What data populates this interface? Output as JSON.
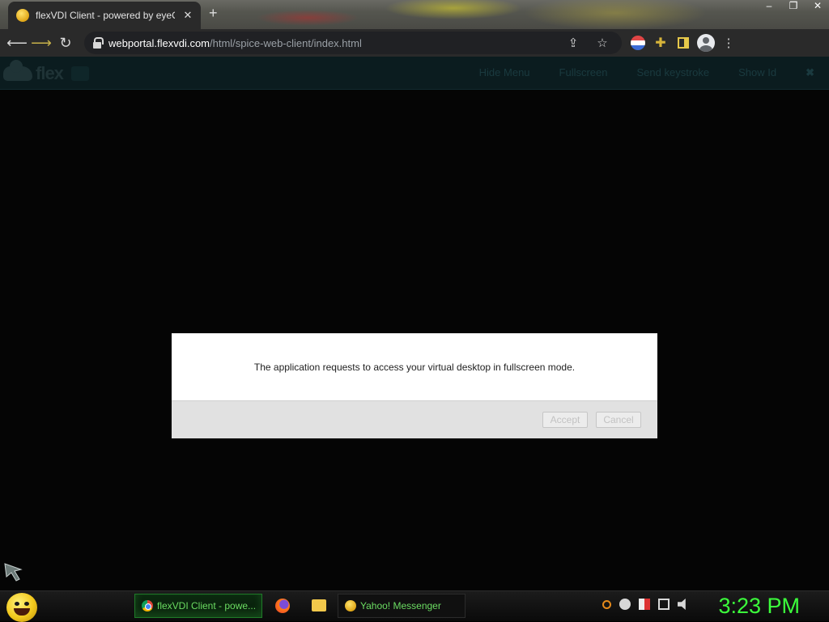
{
  "browser": {
    "tab": {
      "title": "flexVDI Client - powered by eyeO"
    },
    "new_tab_symbol": "+",
    "window_controls": [
      "–",
      "❐",
      "✕"
    ],
    "url": {
      "host": "webportal.flexvdi.com",
      "path": "/html/spice-web-client/index.html"
    },
    "icons": [
      "back-icon",
      "forward-icon",
      "reload-icon",
      "share-icon",
      "star-icon",
      "extension-icon",
      "side-panel-icon",
      "profile-icon",
      "menu-icon"
    ]
  },
  "app": {
    "logo_text": "flex",
    "menu": {
      "hide_menu": "Hide Menu",
      "fullscreen": "Fullscreen",
      "send_keystroke": "Send keystroke",
      "show_id": "Show Id",
      "close": "✖"
    }
  },
  "dialog": {
    "message": "The application requests to access your virtual desktop in fullscreen mode.",
    "accept_label": "Accept",
    "cancel_label": "Cancel"
  },
  "taskbar": {
    "tasks": [
      {
        "label": "flexVDI Client - powe...",
        "icon": "chrome-icon",
        "active": true
      },
      {
        "label": "Yahoo! Messenger",
        "icon": "yahoo-messenger-icon",
        "active": false
      }
    ],
    "clock": "3:23 PM",
    "accent": "#3cff3c"
  }
}
